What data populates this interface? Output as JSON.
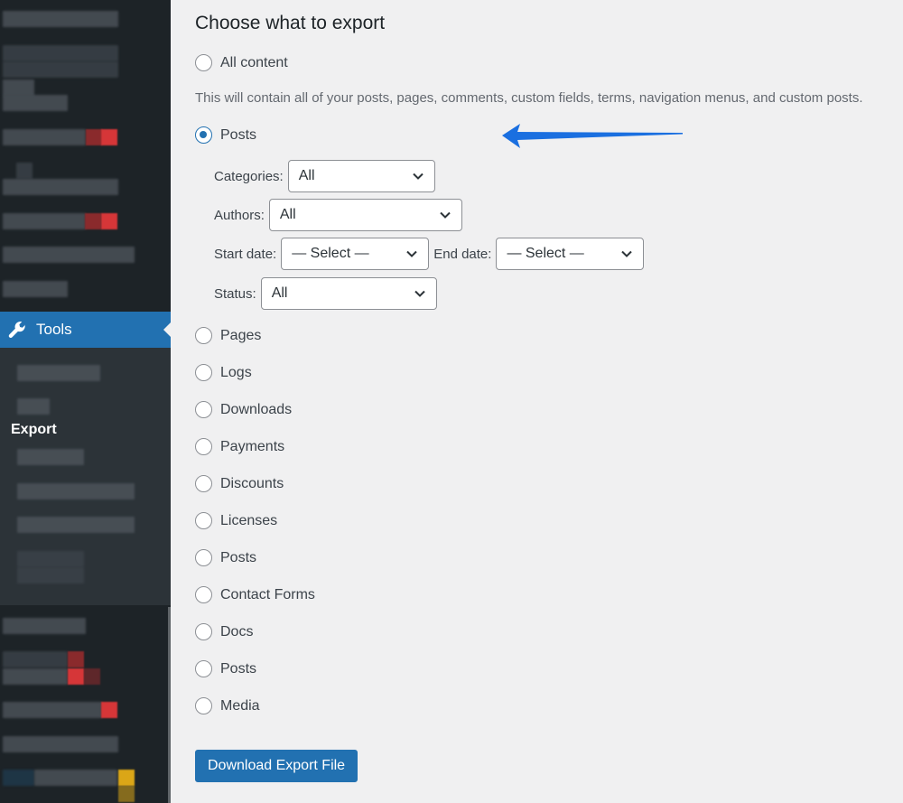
{
  "sidebar": {
    "active_menu": {
      "label": "Tools",
      "icon": "wrench-icon"
    },
    "active_submenu": {
      "label": "Export"
    },
    "accent_color": "#2271b1",
    "note": "other menu items are blurred/obscured"
  },
  "main": {
    "heading": "Choose what to export",
    "all_content": {
      "label": "All content",
      "checked": false
    },
    "all_content_description": "This will contain all of your posts, pages, comments, custom fields, terms, navigation menus, and custom posts.",
    "posts": {
      "label": "Posts",
      "checked": true
    },
    "filters": {
      "categories": {
        "label": "Categories:",
        "value": "All"
      },
      "authors": {
        "label": "Authors:",
        "value": "All"
      },
      "start_date": {
        "label": "Start date:",
        "value": "— Select —"
      },
      "end_date": {
        "label": "End date:",
        "value": "— Select —"
      },
      "status": {
        "label": "Status:",
        "value": "All"
      }
    },
    "options": [
      {
        "label": "Pages",
        "checked": false
      },
      {
        "label": "Logs",
        "checked": false
      },
      {
        "label": "Downloads",
        "checked": false
      },
      {
        "label": "Payments",
        "checked": false
      },
      {
        "label": "Discounts",
        "checked": false
      },
      {
        "label": "Licenses",
        "checked": false
      },
      {
        "label": "Posts",
        "checked": false
      },
      {
        "label": "Contact Forms",
        "checked": false
      },
      {
        "label": "Docs",
        "checked": false
      },
      {
        "label": "Posts",
        "checked": false
      },
      {
        "label": "Media",
        "checked": false
      }
    ],
    "download_button": "Download Export File",
    "annotation_arrow_color": "#1a6fe0"
  }
}
